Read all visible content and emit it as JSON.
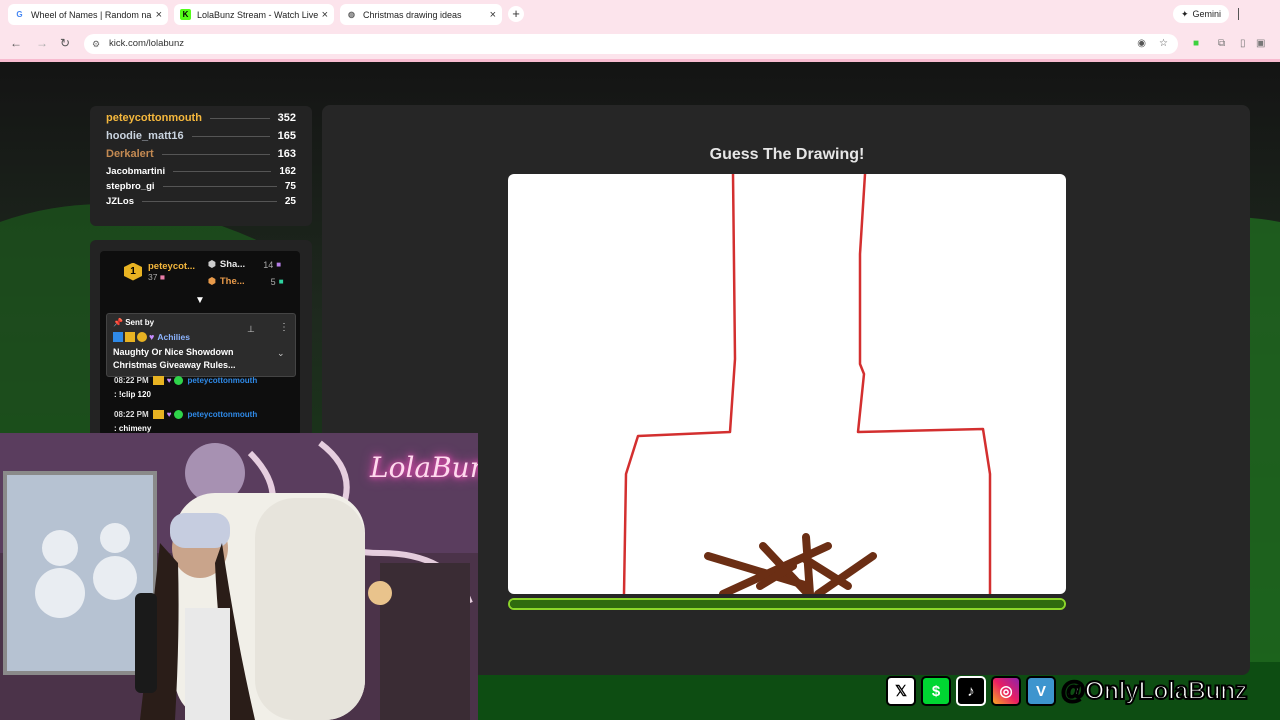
{
  "browser": {
    "tabs": [
      {
        "title": "Wheel of Names | Random nam",
        "icon": "google-icon",
        "color": "#4285f4"
      },
      {
        "title": "LolaBunz Stream - Watch Live o",
        "icon": "kick-icon",
        "color": "#53fc18"
      },
      {
        "title": "Christmas drawing ideas",
        "icon": "globe-icon",
        "color": "#666666"
      }
    ],
    "gemini_label": "Gemini",
    "url": "kick.com/lolabunz"
  },
  "leaderboard": [
    {
      "name": "peteycottonmouth",
      "points": "352",
      "color": "#f5b83d"
    },
    {
      "name": "hoodie_matt16",
      "points": "165",
      "color": "#c9d3df"
    },
    {
      "name": "Derkalert",
      "points": "163",
      "color": "#c48a52"
    },
    {
      "name": "Jacobmartini",
      "points": "162",
      "color": "#ffffff"
    },
    {
      "name": "stepbro_gi",
      "points": "75",
      "color": "#ffffff"
    },
    {
      "name": "JZLos",
      "points": "25",
      "color": "#ffffff"
    }
  ],
  "chat": {
    "top_user": {
      "rank": "1",
      "name": "peteycot...",
      "count": "37"
    },
    "gifters": [
      {
        "name": "Sha...",
        "count": "14"
      },
      {
        "name": "The...",
        "count": "5"
      }
    ],
    "pinned": {
      "label": "Sent by",
      "sender": "Achilies",
      "text": "Naughty Or Nice Showdown Christmas Giveaway Rules..."
    },
    "messages": [
      {
        "time": "08:22 PM",
        "user": "peteycottonmouth",
        "text": ": !clip 120"
      },
      {
        "time": "08:22 PM",
        "user": "peteycottonmouth",
        "text": ": chimeny"
      }
    ]
  },
  "game": {
    "title": "Guess The Drawing!",
    "timer_fraction": 1.0,
    "drawing_colors": {
      "chimney": "#d32f2f",
      "logs": "#6b2e14"
    }
  },
  "overlay": {
    "webcam_sign": "LolaBunz",
    "social_handle": "@OnlyLolaBunz",
    "social_icons": [
      "x-icon",
      "cashapp-icon",
      "tiktok-icon",
      "instagram-icon",
      "venmo-icon"
    ]
  }
}
